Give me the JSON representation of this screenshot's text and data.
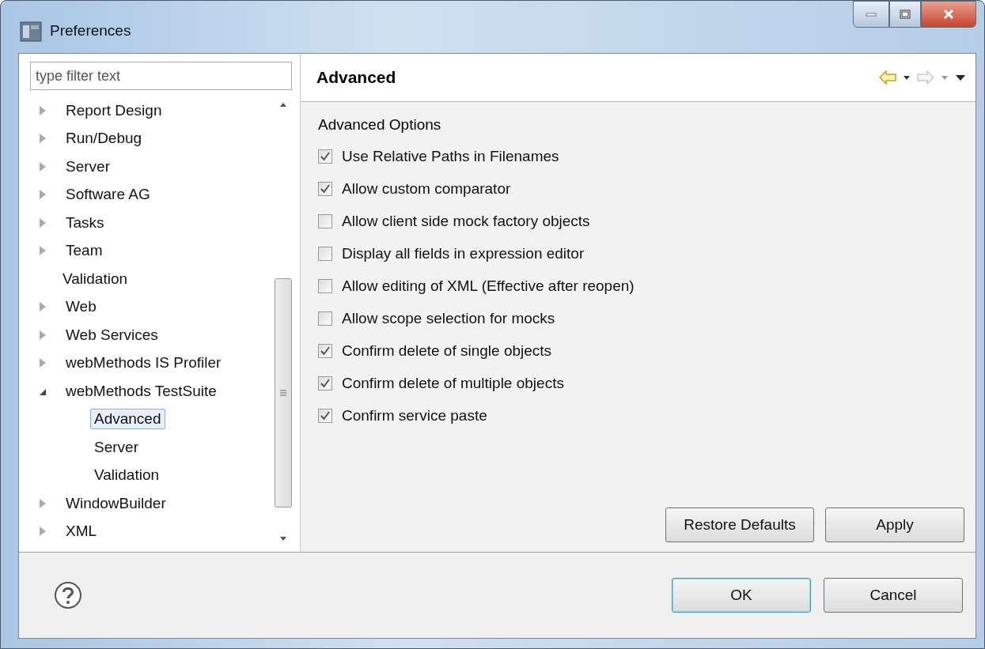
{
  "window": {
    "title": "Preferences"
  },
  "filter": {
    "placeholder": "type filter text"
  },
  "tree": [
    {
      "label": "Report Design",
      "expanded": false,
      "selected": false
    },
    {
      "label": "Run/Debug",
      "expanded": false,
      "selected": false
    },
    {
      "label": "Server",
      "expanded": false,
      "selected": false
    },
    {
      "label": "Software AG",
      "expanded": false,
      "selected": false
    },
    {
      "label": "Tasks",
      "expanded": false,
      "selected": false
    },
    {
      "label": "Team",
      "expanded": false,
      "selected": false
    },
    {
      "label": "Validation",
      "selected": false
    },
    {
      "label": "Web",
      "expanded": false,
      "selected": false
    },
    {
      "label": "Web Services",
      "expanded": false,
      "selected": false
    },
    {
      "label": "webMethods IS Profiler",
      "expanded": false,
      "selected": false
    },
    {
      "label": "webMethods TestSuite",
      "expanded": true,
      "selected": false,
      "children": [
        {
          "label": "Advanced",
          "selected": true
        },
        {
          "label": "Server",
          "selected": false
        },
        {
          "label": "Validation",
          "selected": false
        }
      ]
    },
    {
      "label": "WindowBuilder",
      "expanded": false,
      "selected": false
    },
    {
      "label": "XML",
      "expanded": false,
      "selected": false
    }
  ],
  "page": {
    "title": "Advanced",
    "group_label": "Advanced Options",
    "options": [
      {
        "label": "Use Relative Paths in Filenames",
        "checked": true
      },
      {
        "label": "Allow custom comparator",
        "checked": true
      },
      {
        "label": "Allow client side mock factory objects",
        "checked": false
      },
      {
        "label": "Display all fields in expression editor",
        "checked": false
      },
      {
        "label": "Allow editing of XML (Effective after reopen)",
        "checked": false
      },
      {
        "label": "Allow scope selection for mocks",
        "checked": false
      },
      {
        "label": "Confirm delete of single objects",
        "checked": true
      },
      {
        "label": "Confirm delete of multiple objects",
        "checked": true
      },
      {
        "label": "Confirm service paste",
        "checked": true
      }
    ],
    "buttons": [
      "Restore Defaults",
      "Apply"
    ]
  },
  "dialog_buttons": [
    {
      "label": "OK",
      "default": true
    },
    {
      "label": "Cancel",
      "default": false
    }
  ]
}
